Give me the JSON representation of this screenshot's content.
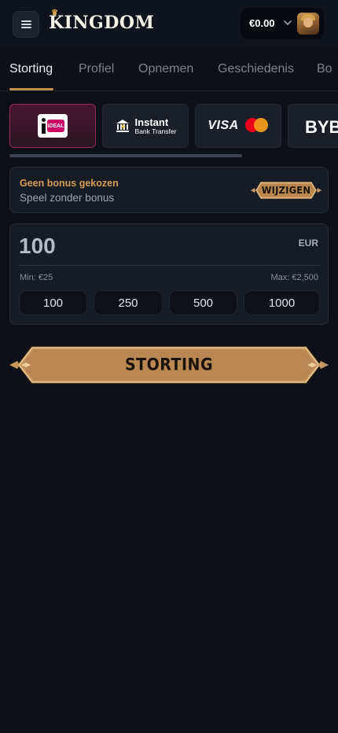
{
  "header": {
    "menu_icon": "hamburger-menu-icon",
    "logo_text": "KINGDOM",
    "balance": "€0.00",
    "chevron_icon": "chevron-down-icon",
    "avatar_icon": "user-avatar-icon"
  },
  "tabs": [
    {
      "label": "Storting",
      "active": true
    },
    {
      "label": "Profiel",
      "active": false
    },
    {
      "label": "Opnemen",
      "active": false
    },
    {
      "label": "Geschiedenis",
      "active": false
    },
    {
      "label": "Bo",
      "active": false
    }
  ],
  "payment_methods": [
    {
      "id": "ideal",
      "label": "iDEAL",
      "selected": true
    },
    {
      "id": "instant-bank-transfer",
      "title": "Instant",
      "subtitle": "Bank Transfer",
      "selected": false
    },
    {
      "id": "visa-mastercard",
      "visa": "VISA",
      "mastercard_caption": "mastercard",
      "selected": false
    },
    {
      "id": "bybit",
      "label": "BYB",
      "selected": false
    }
  ],
  "bonus": {
    "title": "Geen bonus gekozen",
    "subtitle": "Speel zonder bonus",
    "change_label": "WIJZIGEN"
  },
  "amount": {
    "value": "100",
    "currency": "EUR",
    "min": "Min: €25",
    "max": "Max: €2,500",
    "quick_amounts": [
      "100",
      "250",
      "500",
      "1000"
    ]
  },
  "deposit_button": "STORTING",
  "colors": {
    "background": "#0d1016",
    "accent_gold": "#c48f4a",
    "bonus_title": "#d59d55",
    "ideal_selected": "#8e2a58"
  }
}
